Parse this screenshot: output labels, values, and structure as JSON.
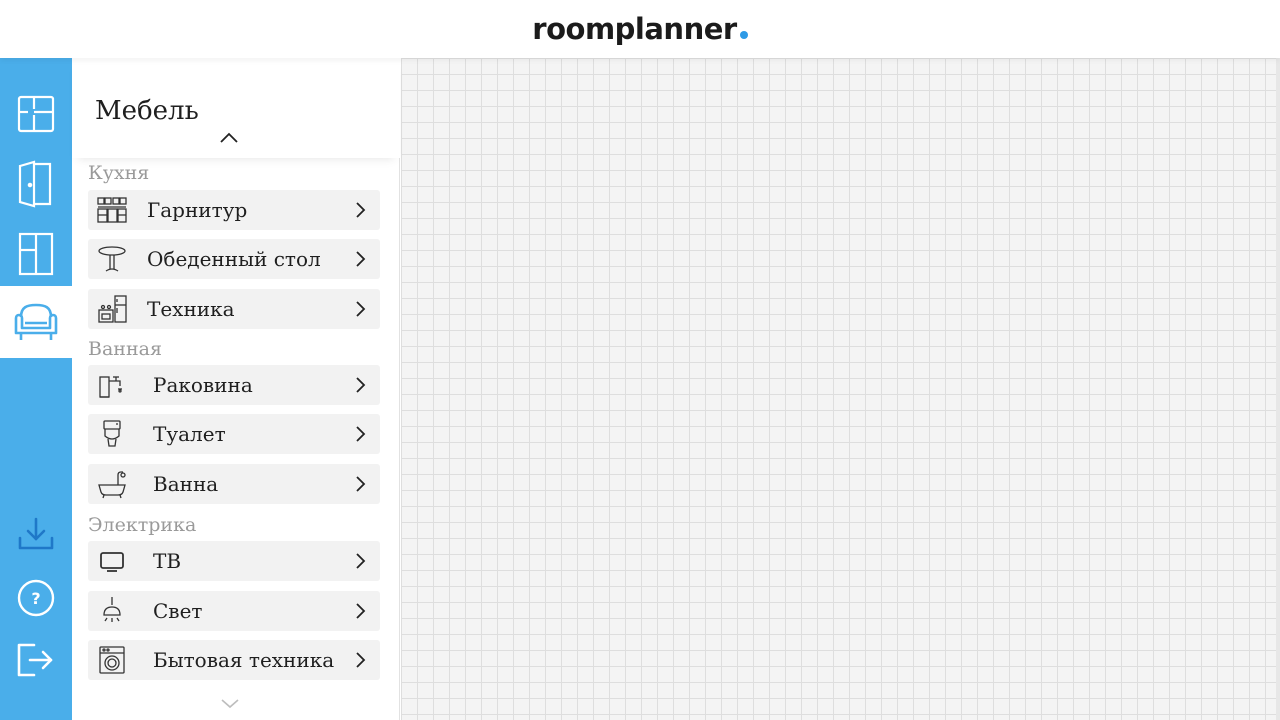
{
  "app": {
    "logo_text": "roomplanner",
    "brand_color": "#4aaeea",
    "accent_dot_color": "#2e9ae6"
  },
  "rail": {
    "items": [
      {
        "name": "floorplan-icon",
        "active": false
      },
      {
        "name": "door-icon",
        "active": false
      },
      {
        "name": "window-icon",
        "active": false
      },
      {
        "name": "armchair-icon",
        "active": true
      },
      {
        "name": "download-icon",
        "active": false
      },
      {
        "name": "help-icon",
        "active": false
      },
      {
        "name": "logout-icon",
        "active": false
      }
    ],
    "help_glyph": "?"
  },
  "panel": {
    "title": "Мебель",
    "sections": [
      {
        "label": "Кухня",
        "items": [
          {
            "label": "Гарнитур",
            "icon": "kitchen-cabinets-icon"
          },
          {
            "label": "Обеденный стол",
            "icon": "dining-table-icon"
          },
          {
            "label": "Техника",
            "icon": "kitchen-appliances-icon"
          }
        ]
      },
      {
        "label": "Ванная",
        "items": [
          {
            "label": "Раковина",
            "icon": "sink-icon"
          },
          {
            "label": "Туалет",
            "icon": "toilet-icon"
          },
          {
            "label": "Ванна",
            "icon": "bathtub-icon"
          }
        ]
      },
      {
        "label": "Электрика",
        "items": [
          {
            "label": "ТВ",
            "icon": "tv-icon"
          },
          {
            "label": "Свет",
            "icon": "lamp-icon"
          },
          {
            "label": "Бытовая техника",
            "icon": "washing-machine-icon"
          }
        ]
      }
    ]
  }
}
